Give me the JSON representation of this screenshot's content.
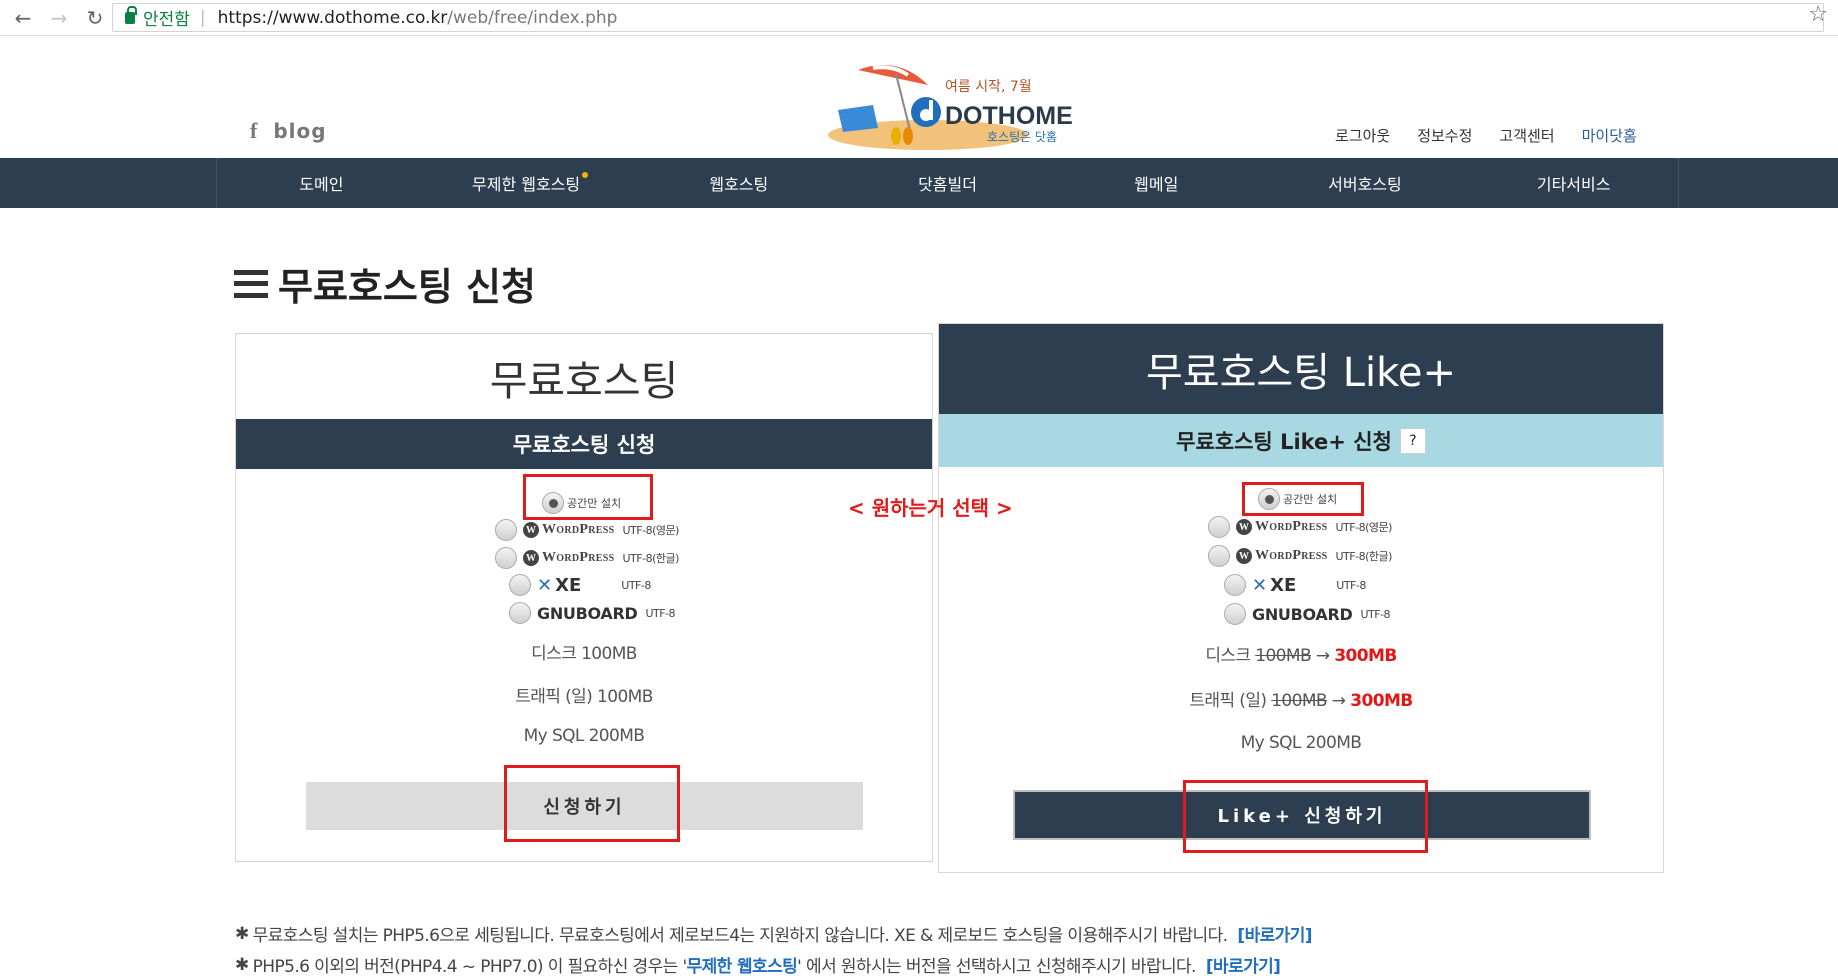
{
  "browser": {
    "back_icon": "back-arrow-icon",
    "forward_icon": "forward-arrow-icon",
    "reload_icon": "reload-icon",
    "secure_label": "안전함",
    "url_host": "https://www.dothome.co.kr",
    "url_path": "/web/free/index.php",
    "bookmark_icon": "star-icon"
  },
  "header": {
    "facebook": "f",
    "blog": "blog",
    "logo_script": "여름 시작, 7월",
    "logo_title": "DOTHOME",
    "logo_sub": "호스팅은 닷홈",
    "top_links": [
      "로그아웃",
      "정보수정",
      "고객센터",
      "마이닷홈"
    ]
  },
  "nav": {
    "items": [
      "도메인",
      "무제한 웹호스팅",
      "웹호스팅",
      "닷홈빌더",
      "웹메일",
      "서버호스팅",
      "기타서비스"
    ],
    "accent": "#f7b500"
  },
  "page": {
    "title": "무료호스팅 신청"
  },
  "free": {
    "title": "무료호스팅",
    "bar": "무료호스팅 신청",
    "option_space": "공간만 설치",
    "wp": "WordPress",
    "wp_en": "UTF-8(영문)",
    "wp_ko": "UTF-8(한글)",
    "xe": "XE",
    "xe_enc": "UTF-8",
    "gnu": "GNUBOARD",
    "gnu_enc": "UTF-8",
    "disk": "디스크 100MB",
    "traffic": "트래픽 (일) 100MB",
    "mysql": "My SQL 200MB",
    "button": "신청하기"
  },
  "plus": {
    "title": "무료호스팅 Like+",
    "bar": "무료호스팅 Like+ 신청",
    "help": "?",
    "option_space": "공간만 설치",
    "wp": "WordPress",
    "wp_en": "UTF-8(영문)",
    "wp_ko": "UTF-8(한글)",
    "xe": "XE",
    "xe_enc": "UTF-8",
    "gnu": "GNUBOARD",
    "gnu_enc": "UTF-8",
    "disk_label": "디스크",
    "disk_old": "100MB",
    "disk_new": "300MB",
    "traffic_label": "트래픽 (일)",
    "traffic_old": "100MB",
    "traffic_new": "300MB",
    "arrow": "→",
    "mysql": "My SQL 200MB",
    "button": "Like+ 신청하기"
  },
  "annotation": {
    "text": "< 원하는거 선택 >",
    "color": "#e01b1b"
  },
  "notes": {
    "asterisk": "✱",
    "n1_text": "무료호스팅 설치는 PHP5.6으로 세팅됩니다. 무료호스팅에서 제로보드4는 지원하지 않습니다. XE & 제로보드 호스팅을 이용해주시기 바랍니다.",
    "n1_link": "[바로가기]",
    "n2_pre": "PHP5.6 이외의 버전(PHP4.4 ~ PHP7.0) 이 필요하신 경우는 '",
    "n2_highlight": "무제한 웹호스팅",
    "n2_post": "' 에서 원하시는 버전을 선택하시고 신청해주시기 바랍니다.",
    "n2_link": "[바로가기]"
  },
  "colors": {
    "navy": "#2c3e50",
    "light_blue": "#a8d8e1",
    "red": "#e01818",
    "link_blue": "#1f6fbe"
  }
}
